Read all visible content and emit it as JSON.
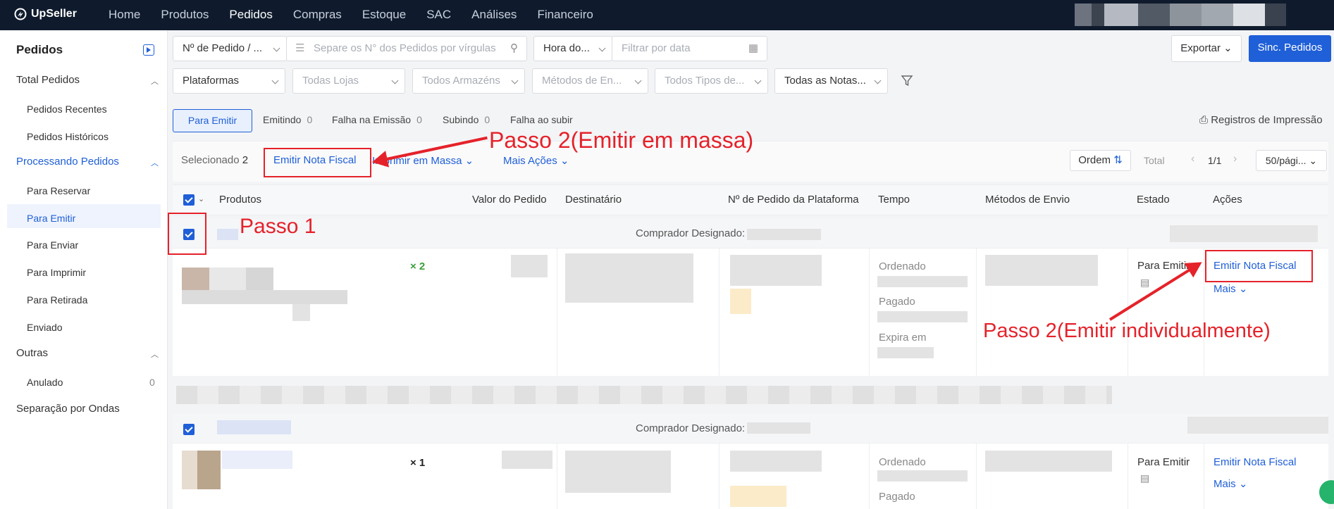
{
  "app": {
    "brand": "UpSeller"
  },
  "nav": [
    "Home",
    "Produtos",
    "Pedidos",
    "Compras",
    "Estoque",
    "SAC",
    "Análises",
    "Financeiro"
  ],
  "nav_active": "Pedidos",
  "sidebar": {
    "title": "Pedidos",
    "total_pedidos": "Total Pedidos",
    "recentes": "Pedidos Recentes",
    "historicos": "Pedidos Históricos",
    "processando": "Processando Pedidos",
    "reservar": "Para Reservar",
    "emitir": "Para Emitir",
    "enviar": "Para Enviar",
    "imprimir": "Para Imprimir",
    "retirada": "Para Retirada",
    "enviado": "Enviado",
    "outras": "Outras",
    "anulado": "Anulado",
    "anulado_count": "0",
    "ondas": "Separação por Ondas"
  },
  "filters": {
    "order_no_select": "Nº de Pedido / ...",
    "order_no_placeholder": "Separe os N° dos Pedidos por vírgulas",
    "time_select": "Hora do...",
    "date_placeholder": "Filtrar por data",
    "plataformas": "Plataformas",
    "lojas": "Todas Lojas",
    "armazens": "Todos Armazéns",
    "metodos": "Métodos de En...",
    "tipos": "Todos Tipos de...",
    "notas": "Todas as Notas..."
  },
  "toolbar": {
    "exportar": "Exportar",
    "sinc": "Sinc. Pedidos",
    "registros": "Registros de Impressão"
  },
  "tabs": [
    {
      "label": "Para Emitir",
      "count": ""
    },
    {
      "label": "Emitindo",
      "count": "0"
    },
    {
      "label": "Falha na Emissão",
      "count": "0"
    },
    {
      "label": "Subindo",
      "count": "0"
    },
    {
      "label": "Falha ao subir",
      "count": ""
    }
  ],
  "bulk": {
    "selected_label": "Selecionado",
    "selected_count": "2",
    "emitir": "Emitir Nota Fiscal",
    "imprimir": "Imprimir em Massa",
    "mais": "Mais Ações",
    "ordem": "Ordem",
    "total": "Total",
    "page": "1/1",
    "per_page": "50/pági..."
  },
  "columns": [
    "Produtos",
    "Valor do Pedido",
    "Destinatário",
    "Nº de Pedido da Plataforma",
    "Tempo",
    "Métodos de Envio",
    "Estado",
    "Ações"
  ],
  "orders": [
    {
      "comprador": "Comprador Designado:",
      "qty": "× 2",
      "ordenado": "Ordenado",
      "pago": "Pagado",
      "expira": "Expira em",
      "estado": "Para Emitir",
      "acao": "Emitir Nota Fiscal",
      "mais": "Mais"
    },
    {
      "comprador": "Comprador Designado:",
      "qty": "× 1",
      "ordenado": "Ordenado",
      "pago": "Pagado",
      "estado": "Para Emitir",
      "acao": "Emitir Nota Fiscal",
      "mais": "Mais"
    }
  ],
  "annotations": {
    "passo1": "Passo 1",
    "passo2_massa": "Passo 2(Emitir em massa)",
    "passo2_indiv": "Passo 2(Emitir individualmente)"
  },
  "colors": {
    "accent": "#1f5fd8",
    "annotation": "#e5222a",
    "topbar": "#0f1b2d",
    "qty_green": "#3aa03a"
  }
}
